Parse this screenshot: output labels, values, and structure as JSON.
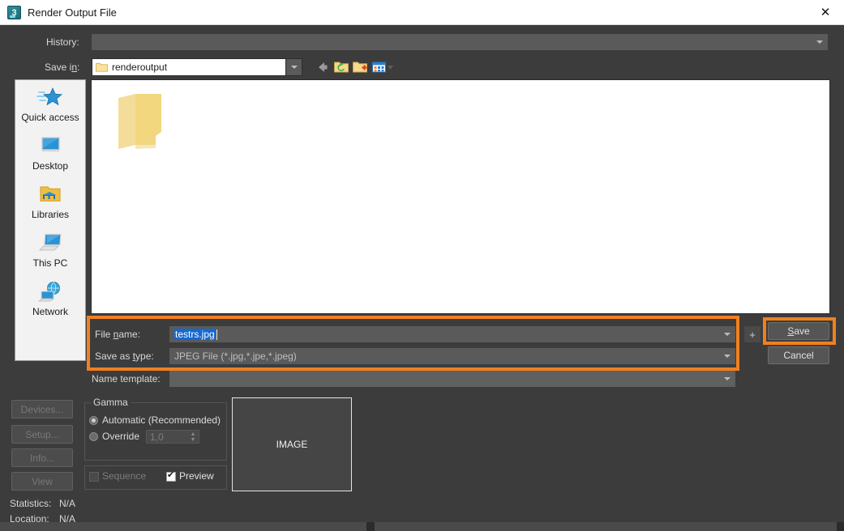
{
  "window": {
    "title": "Render Output File",
    "icon": "max3-icon",
    "icon_glyph": "3",
    "close_label": "✕"
  },
  "toolbar": {
    "history_label": "History:",
    "history_value": "",
    "savein_label": "Save in:",
    "savein_value": "renderoutput",
    "icons": [
      {
        "name": "back-arrow-icon",
        "title": "Back"
      },
      {
        "name": "up-one-level-icon",
        "title": "Up One Level"
      },
      {
        "name": "create-new-folder-icon",
        "title": "Create New Folder"
      },
      {
        "name": "views-icon",
        "title": "Views"
      }
    ]
  },
  "places": {
    "items": [
      {
        "label": "Quick access",
        "icon": "star-icon"
      },
      {
        "label": "Desktop",
        "icon": "monitor-icon"
      },
      {
        "label": "Libraries",
        "icon": "libraries-folder-icon"
      },
      {
        "label": "This PC",
        "icon": "computer-icon"
      },
      {
        "label": "Network",
        "icon": "globe-network-icon"
      }
    ]
  },
  "filelist": {
    "items": [
      {
        "name": "",
        "icon": "folder-icon"
      }
    ]
  },
  "form": {
    "filename_label": "File name:",
    "filename_label_pre": "File ",
    "filename_label_accel": "n",
    "filename_label_post": "ame:",
    "filename_value": "testrs.jpg",
    "savetype_label": "Save as type:",
    "savetype_label_pre": "Save as ",
    "savetype_label_accel": "t",
    "savetype_label_post": "ype:",
    "savetype_value": "JPEG File (*.jpg,*.jpe,*.jpeg)",
    "nametemplate_label": "Name template:",
    "nametemplate_value": "",
    "plus_label": "+"
  },
  "buttons": {
    "save_label": "Save",
    "save_accel": "S",
    "save_rest": "ave",
    "cancel_label": "Cancel",
    "devices_label": "Devices...",
    "setup_label": "Setup...",
    "info_label": "Info...",
    "view_label": "View"
  },
  "gamma": {
    "legend": "Gamma",
    "automatic_label": "Automatic (Recommended)",
    "override_label": "Override",
    "override_value": "1,0",
    "selected": "automatic"
  },
  "options": {
    "sequence_label": "Sequence",
    "sequence_checked": false,
    "sequence_enabled": false,
    "preview_label": "Preview",
    "preview_checked": true
  },
  "preview": {
    "placeholder": "IMAGE"
  },
  "status": {
    "statistics_label": "Statistics:",
    "statistics_value": "N/A",
    "location_label": "Location:",
    "location_value": "N/A"
  },
  "highlights": {
    "accent_color": "#f08020",
    "regions": [
      "filename-and-type-fields",
      "save-button"
    ]
  }
}
